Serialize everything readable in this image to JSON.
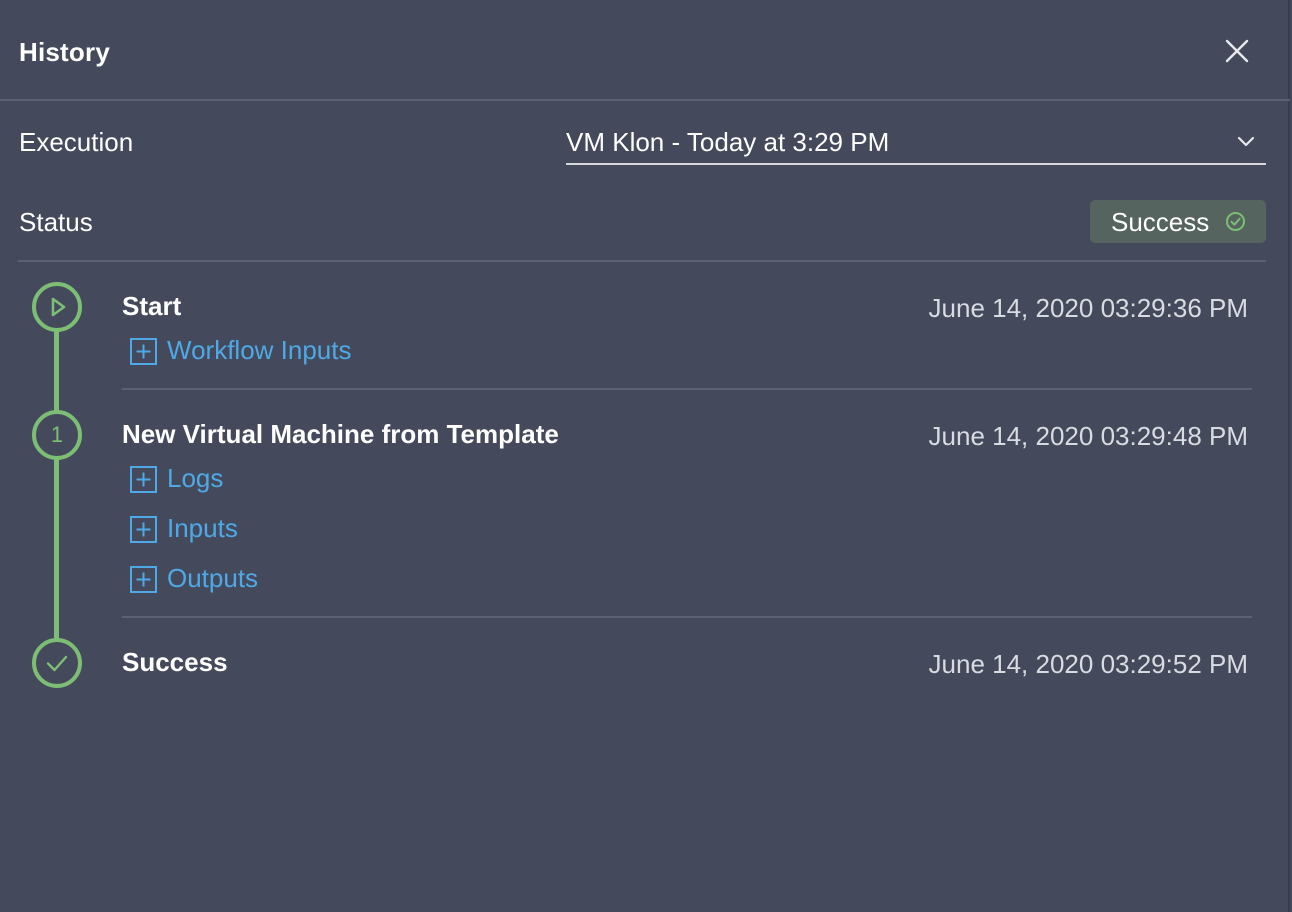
{
  "header": {
    "title": "History",
    "close_icon": "close-icon"
  },
  "execution": {
    "label": "Execution",
    "selected": "VM Klon - Today at 3:29 PM"
  },
  "status": {
    "label": "Status",
    "badge": "Success",
    "badge_icon": "check-circle-icon"
  },
  "steps": [
    {
      "title": "Start",
      "time": "June 14, 2020 03:29:36 PM",
      "icon": "play-icon",
      "sections": [
        "Workflow Inputs"
      ]
    },
    {
      "title": "New Virtual Machine from Template",
      "time": "June 14, 2020 03:29:48 PM",
      "number": "1",
      "sections": [
        "Logs",
        "Inputs",
        "Outputs"
      ]
    },
    {
      "title": "Success",
      "time": "June 14, 2020 03:29:52 PM",
      "icon": "checkmark-icon",
      "sections": []
    }
  ],
  "colors": {
    "background": "#444a5c",
    "accent_green": "#7cbf74",
    "link_blue": "#4ea9e6",
    "badge_bg": "#56645f"
  }
}
